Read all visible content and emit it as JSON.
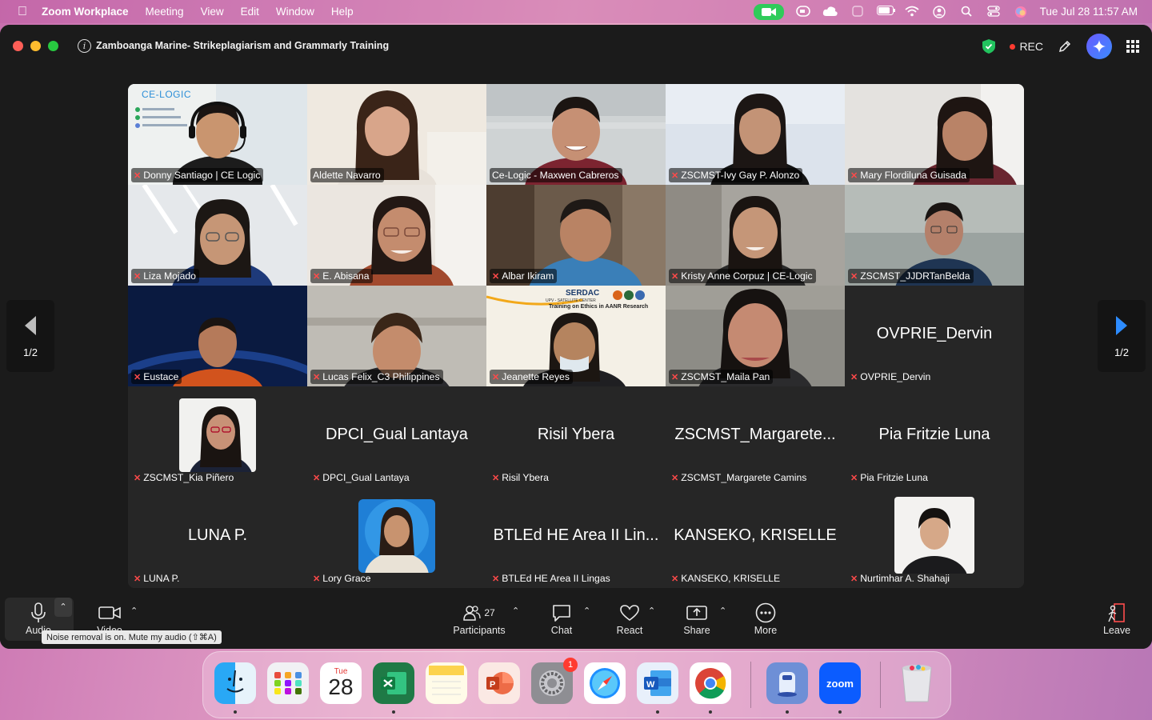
{
  "menubar": {
    "app_name": "Zoom Workplace",
    "menus": [
      "Meeting",
      "View",
      "Edit",
      "Window",
      "Help"
    ],
    "clock": "Tue Jul 28  11:57 AM"
  },
  "window": {
    "meeting_title": "Zamboanga Marine- Strikeplagiarism and Grammarly Training",
    "rec_label": "REC"
  },
  "paging": {
    "left_label": "1/2",
    "right_label": "1/2"
  },
  "tiles": [
    {
      "name": "Donny Santiago | CE Logic",
      "kind": "video",
      "muted": true
    },
    {
      "name": "Aldette Navarro",
      "kind": "video",
      "muted": false,
      "active": true
    },
    {
      "name": "Ce-Logic - Maxwen Cabreros",
      "kind": "video",
      "muted": false
    },
    {
      "name": "ZSCMST-Ivy Gay P. Alonzo",
      "kind": "video",
      "muted": true
    },
    {
      "name": "Mary Flordiluna Guisada",
      "kind": "video",
      "muted": true
    },
    {
      "name": "Liza Mojado",
      "kind": "video",
      "muted": true
    },
    {
      "name": "E. Abisana",
      "kind": "video",
      "muted": true
    },
    {
      "name": "Albar Ikiram",
      "kind": "video",
      "muted": true
    },
    {
      "name": "Kristy Anne Corpuz | CE-Logic",
      "kind": "video",
      "muted": true
    },
    {
      "name": "ZSCMST_JJDRTanBelda",
      "kind": "video",
      "muted": true
    },
    {
      "name": "Eustace",
      "kind": "video",
      "muted": true
    },
    {
      "name": "Lucas Felix_C3 Philippines",
      "kind": "video",
      "muted": true
    },
    {
      "name": "Jeanette Reyes",
      "kind": "video",
      "muted": true
    },
    {
      "name": "ZSCMST_Maila Pan",
      "kind": "video",
      "muted": true
    },
    {
      "name": "OVPRIE_Dervin",
      "kind": "name",
      "big": "OVPRIE_Dervin",
      "muted": true
    },
    {
      "name": "ZSCMST_Kia Piñero",
      "kind": "avatar",
      "muted": true
    },
    {
      "name": "DPCI_Gual Lantaya",
      "kind": "name",
      "big": "DPCI_Gual Lantaya",
      "muted": true
    },
    {
      "name": "Risil Ybera",
      "kind": "name",
      "big": "Risil Ybera",
      "muted": true
    },
    {
      "name": "ZSCMST_Margarete Camins",
      "kind": "name",
      "big": "ZSCMST_Margarete...",
      "muted": true
    },
    {
      "name": "Pia Fritzie Luna",
      "kind": "name",
      "big": "Pia Fritzie Luna",
      "muted": true
    },
    {
      "name": "LUNA P.",
      "kind": "name",
      "big": "LUNA P.",
      "muted": true
    },
    {
      "name": "Lory Grace",
      "kind": "avatar",
      "muted": true
    },
    {
      "name": "BTLEd HE Area II Lingas",
      "kind": "name",
      "big": "BTLEd HE Area II Lin...",
      "muted": true
    },
    {
      "name": "KANSEKO, KRISELLE",
      "kind": "name",
      "big": "KANSEKO, KRISELLE",
      "muted": true
    },
    {
      "name": "Nurtimhar A. Shahaji",
      "kind": "avatar",
      "muted": true
    }
  ],
  "video_overlays": {
    "logo_text": "CE-LOGIC",
    "serdac": "SERDAC",
    "serdac_sub": "UPV - SATELLITE CENTER",
    "serdac_line": "Training on Ethics in AANR Research"
  },
  "controls": {
    "audio_label": "Audio",
    "video_label": "Video",
    "tooltip": "Noise removal is on. Mute my audio (⇧⌘A)",
    "participants_label": "Participants",
    "participants_count": "27",
    "chat_label": "Chat",
    "react_label": "React",
    "share_label": "Share",
    "more_label": "More",
    "leave_label": "Leave"
  },
  "dock": {
    "calendar_month": "Tue",
    "calendar_day": "28",
    "settings_badge": "1",
    "zoom_text": "zoom"
  },
  "colors": {
    "active_speaker": "#23d15a",
    "window_bg": "#1b1b1b",
    "tile_bg": "#262626",
    "muted_red": "#ff4a4a",
    "rec_red": "#ff3b30"
  }
}
